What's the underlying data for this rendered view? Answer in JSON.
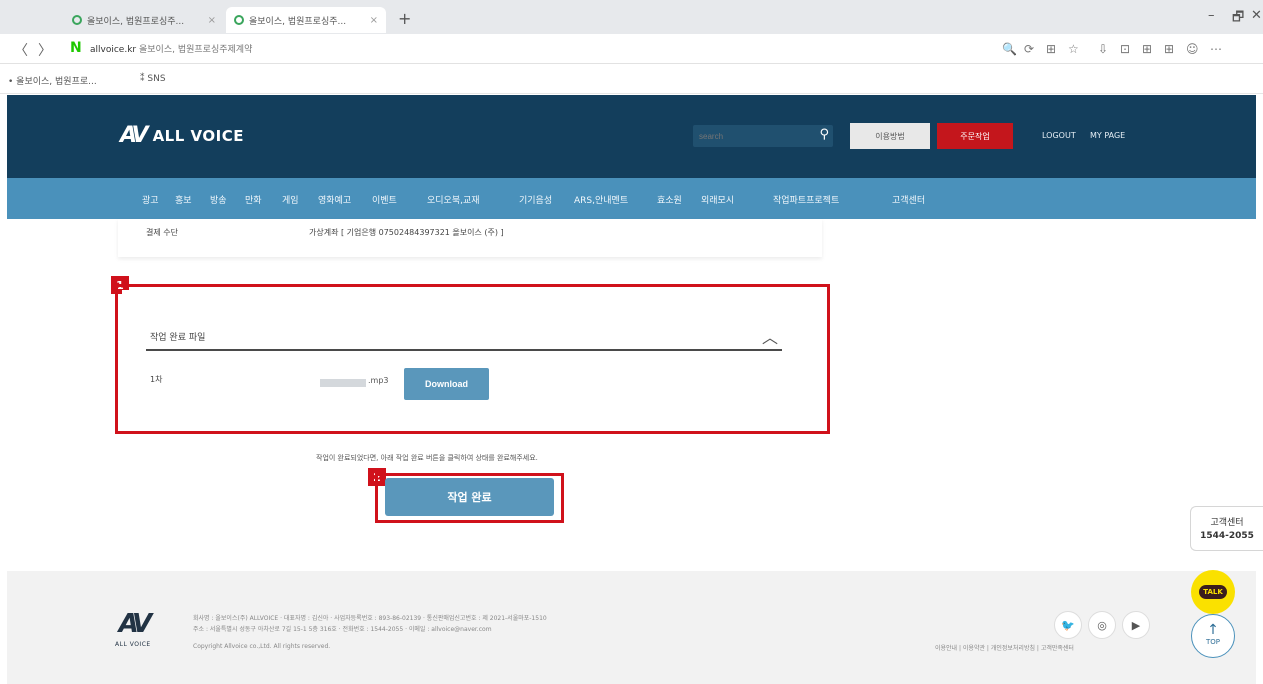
{
  "browser": {
    "tabs": [
      {
        "title": "올보이스, 법원프로싱주..."
      },
      {
        "title": "올보이스, 법원프로싱주..."
      }
    ],
    "tab_close": "×",
    "new_tab": "+",
    "window": {
      "minimize": "–",
      "restore": "🗗",
      "close": "✕"
    },
    "nav": {
      "back": "〈",
      "forward": "〉"
    },
    "address_site": "allvoice.kr",
    "address_title": "올보이스, 법원프로싱주제계약",
    "bookmarks": [
      {
        "label": "올보이스, 법원프로..."
      },
      {
        "label": "SNS"
      }
    ],
    "toolbar_icons": [
      "🔍",
      "⟳",
      "⊞",
      "☆",
      "⇩",
      "⊡",
      "⊞",
      "⊞",
      "☺",
      "⋯"
    ]
  },
  "header": {
    "logo_mark": "AV",
    "logo_text": "ALL VOICE",
    "search_placeholder": "search",
    "search_icon": "search-icon",
    "guide_button": "이용방법",
    "request_button": "주문작업",
    "logout": "LOGOUT",
    "mypage": "MY PAGE"
  },
  "menu": [
    "광고",
    "홍보",
    "방송",
    "만화",
    "게임",
    "영화예고",
    "이벤트",
    "오디오북,교재",
    "기기음성",
    "ARS,안내멘트",
    "효소원",
    "외래모시",
    "작업파트프로젝트",
    "고객센터"
  ],
  "payment": {
    "label": "결제 수단",
    "value": "가상계좌 [ 기업은행 07502484397321 올보이스 (주) ]"
  },
  "annotations": {
    "mark1": "1",
    "mark2": "2",
    "highlight_color": "#d0111b"
  },
  "file_section": {
    "title": "작업 완료 파일",
    "chevron": "^",
    "round_label": "1차",
    "file_ext": ".mp3",
    "download_button": "Download"
  },
  "notice": "작업이 완료되었다면, 아래 작업 완료 버튼을 클릭하여 상태를 완료해주세요.",
  "complete_button": "작업 완료",
  "side": {
    "cs_label": "고객센터",
    "cs_phone": "1544-2055",
    "talk_label": "TALK",
    "top_arrow": "↑",
    "top_label": "TOP"
  },
  "footer": {
    "logo_mark": "AV",
    "logo_text": "ALL VOICE",
    "info_lines": [
      "회사명 : 올보이스(주) ALLVOICE · 대표자명 : 김신아 · 사업자등록번호 : 893-86-02139 · 통신판매업신고번호 : 제 2021-서울마포-1510",
      "주소 : 서울특별시 성동구 아차산로 7길 15-1 5층 316호 · 전화번호 : 1544-2055 · 이메일 : allvoice@naver.com",
      "Copyright Allvoice co.,Ltd. All rights reserved."
    ],
    "sns": [
      "twitter",
      "instagram",
      "youtube"
    ],
    "links": "이용안내 | 이용약관 | 개인정보처리방침 | 고객만족센터"
  },
  "colors": {
    "header_bg": "#133e5c",
    "menu_bg": "#4a91bb",
    "button_blue": "#5a97bb",
    "accent_red": "#c4161c"
  }
}
